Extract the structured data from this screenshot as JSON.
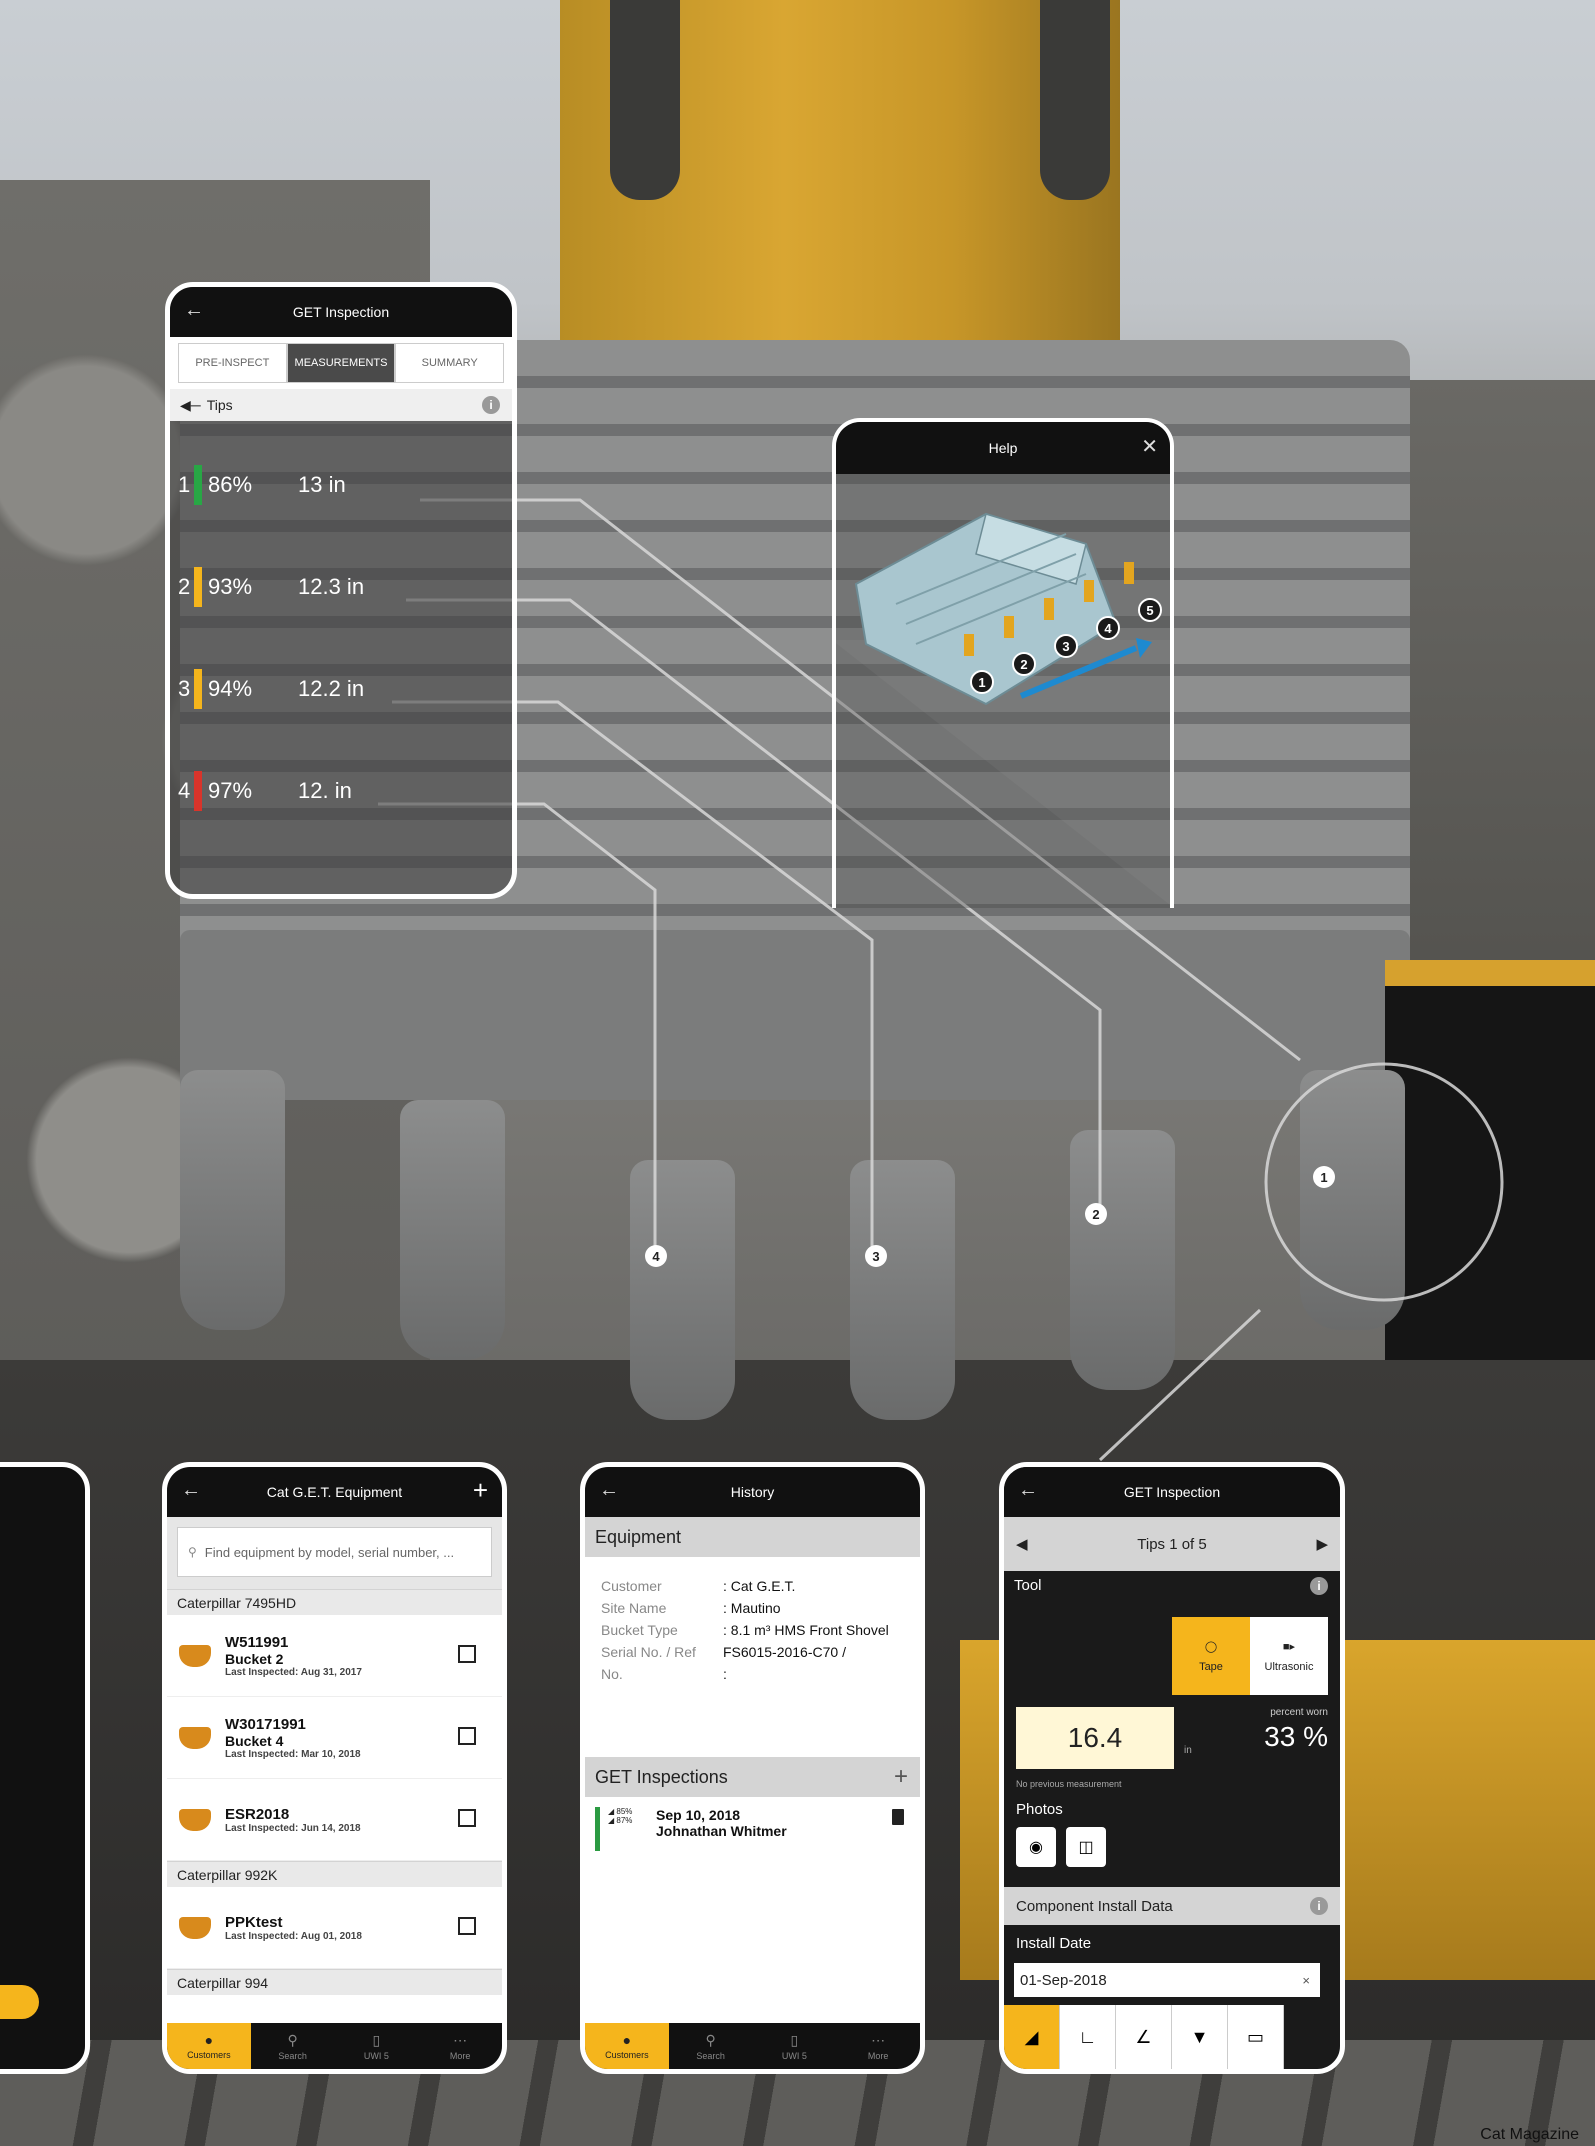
{
  "phone_measure": {
    "title": "GET Inspection",
    "tabs": [
      "PRE-INSPECT",
      "MEASUREMENTS",
      "SUMMARY"
    ],
    "active_tab": "MEASUREMENTS",
    "section_label": "Tips",
    "rows": [
      {
        "num": "1",
        "pct": "86%",
        "val": "13 in",
        "color": "#28a745"
      },
      {
        "num": "2",
        "pct": "93%",
        "val": "12.3 in",
        "color": "#f5b51c"
      },
      {
        "num": "3",
        "pct": "94%",
        "val": "12.2 in",
        "color": "#f5b51c"
      },
      {
        "num": "4",
        "pct": "97%",
        "val": "12. in",
        "color": "#d9342b"
      }
    ]
  },
  "help_panel": {
    "title": "Help",
    "markers": [
      "1",
      "2",
      "3",
      "4",
      "5"
    ]
  },
  "tooth_markers": [
    "1",
    "2",
    "3",
    "4"
  ],
  "phone_equipment": {
    "title": "Cat G.E.T. Equipment",
    "search_placeholder": "Find equipment by model, serial number, ...",
    "groups": [
      {
        "name": "Caterpillar 7495HD",
        "items": [
          {
            "id": "W511991",
            "name": "Bucket 2",
            "last": "Last Inspected: Aug 31, 2017"
          },
          {
            "id": "W30171991",
            "name": "Bucket 4",
            "last": "Last Inspected: Mar 10, 2018"
          },
          {
            "id": "ESR2018",
            "name": "",
            "last": "Last Inspected: Jun 14, 2018"
          }
        ]
      },
      {
        "name": "Caterpillar 992K",
        "items": [
          {
            "id": "PPKtest",
            "name": "",
            "last": "Last Inspected: Aug 01, 2018"
          }
        ]
      },
      {
        "name": "Caterpillar 994",
        "items": []
      }
    ]
  },
  "bottom_nav": [
    "Customers",
    "Search",
    "UWI 5",
    "More"
  ],
  "phone_history": {
    "title": "History",
    "equipment_header": "Equipment",
    "fields": [
      {
        "k": "Customer",
        "v": ": Cat G.E.T."
      },
      {
        "k": "Site Name",
        "v": ": Mautino"
      },
      {
        "k": "Bucket Type",
        "v": ": 8.1 m³ HMS Front Shovel"
      },
      {
        "k": "Serial No. / Ref",
        "v": "FS6015-2016-C70 /"
      },
      {
        "k": "No.",
        "v": ":"
      }
    ],
    "inspections_header": "GET Inspections",
    "inspection": {
      "date": "Sep 10, 2018",
      "inspector": "Johnathan Whitmer",
      "pct1": "85%",
      "pct2": "87%"
    }
  },
  "phone_tool": {
    "title": "GET Inspection",
    "tips_nav": "Tips 1 of 5",
    "tool_label": "Tool",
    "tool_options": [
      "Tape",
      "Ultrasonic"
    ],
    "active_tool": "Tape",
    "value": "16.4",
    "unit": "in",
    "percent_worn_label": "percent worn",
    "percent_worn": "33 %",
    "no_prev": "No previous measurement",
    "photos_label": "Photos",
    "component_header": "Component Install Data",
    "install_date_label": "Install Date",
    "install_date": "01-Sep-2018"
  },
  "credit": "Cat Magazine"
}
